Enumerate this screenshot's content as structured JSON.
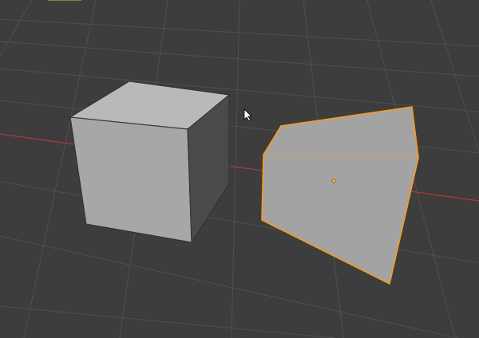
{
  "viewport": {
    "background": "#3d3d3d",
    "grid_color": "#505050",
    "x_axis_color": "#b0393d",
    "y_axis_color": "#6a8f3a"
  },
  "objects": [
    {
      "kind": "cube",
      "selected": false,
      "face_color": "#a8a8a8"
    },
    {
      "kind": "mesh",
      "selected": true,
      "face_color": "#a3a3a3",
      "outline_color": "#ff9a1a"
    }
  ],
  "cursor": {
    "icon": "mouse-pointer-icon"
  }
}
